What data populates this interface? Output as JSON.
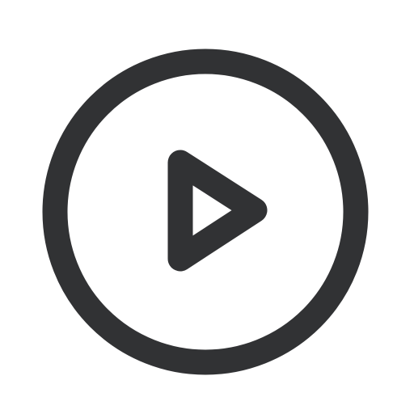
{
  "icon": {
    "name": "play-circle-icon",
    "color": "#313234",
    "background": "#ffffff"
  }
}
